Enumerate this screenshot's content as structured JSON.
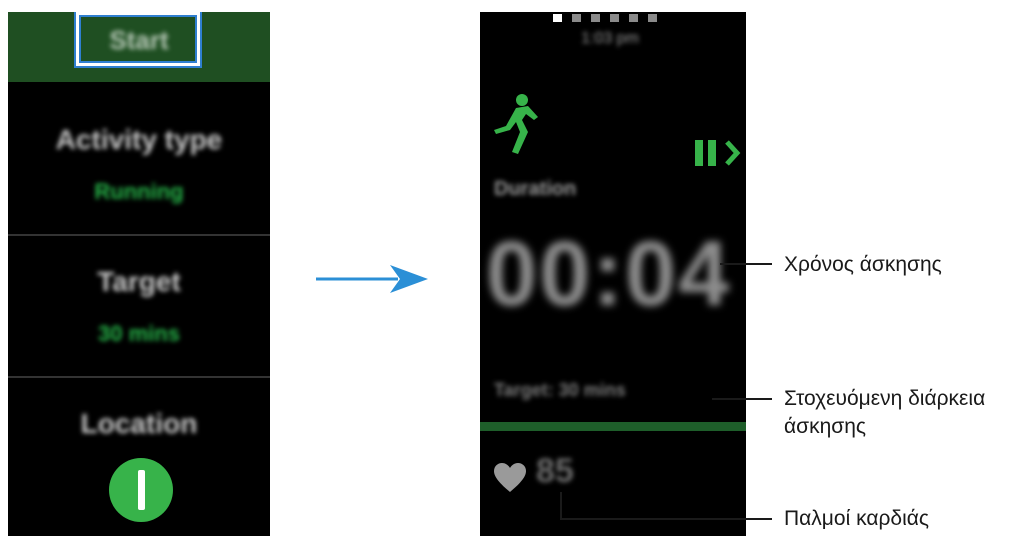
{
  "left_screen": {
    "start_label": "Start",
    "activity_type": {
      "title": "Activity type",
      "value": "Running"
    },
    "target": {
      "title": "Target",
      "value": "30 mins"
    },
    "location": {
      "title": "Location"
    }
  },
  "right_screen": {
    "page_dots": 6,
    "active_dot": 0,
    "clock": "1:03 pm",
    "duration_label": "Duration",
    "duration_value": "00:04",
    "target_label": "Target: 30 mins",
    "heart_rate": "85"
  },
  "callouts": {
    "workout_time": "Χρόνος άσκησης",
    "target_duration_line1": "Στοχευόμενη διάρκεια",
    "target_duration_line2": "άσκησης",
    "heart_rate": "Παλμοί καρδιάς"
  },
  "colors": {
    "accent_green": "#37b34a",
    "highlight_blue": "#2f7fd0",
    "arrow_blue": "#2b8fd6",
    "start_bar_green": "#1f4f22"
  }
}
